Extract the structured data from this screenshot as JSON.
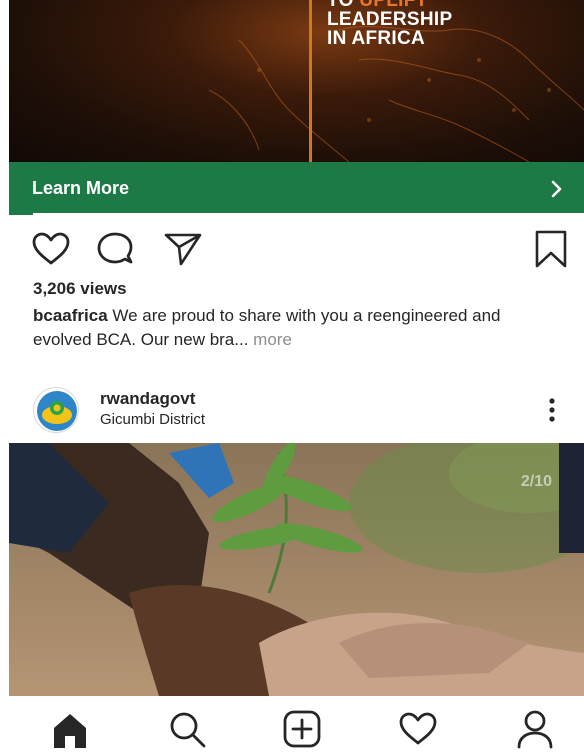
{
  "ad": {
    "headline_partial_1": "TO",
    "headline_partial_2": "UPLIFT",
    "headline_line_2": "LEADERSHIP",
    "headline_line_3": "IN AFRICA",
    "cta_label": "Learn More"
  },
  "post1": {
    "views": "3,206 views",
    "caption_user": "bcaafrica",
    "caption_text": " We are proud to share with you a reengineered and evolved BCA. Our new bra...",
    "caption_more": " more"
  },
  "post2": {
    "username": "rwandagovt",
    "location": "Gicumbi District",
    "carousel_counter": "2/10"
  },
  "nav": {
    "items": [
      {
        "icon": "home-icon"
      },
      {
        "icon": "search-icon"
      },
      {
        "icon": "new-post-icon"
      },
      {
        "icon": "activity-heart-icon"
      },
      {
        "icon": "profile-icon"
      }
    ]
  },
  "colors": {
    "cta_green": "#1d7a46",
    "ad_orange": "#e8762a",
    "text": "#262626",
    "muted": "#8e8e8e"
  }
}
